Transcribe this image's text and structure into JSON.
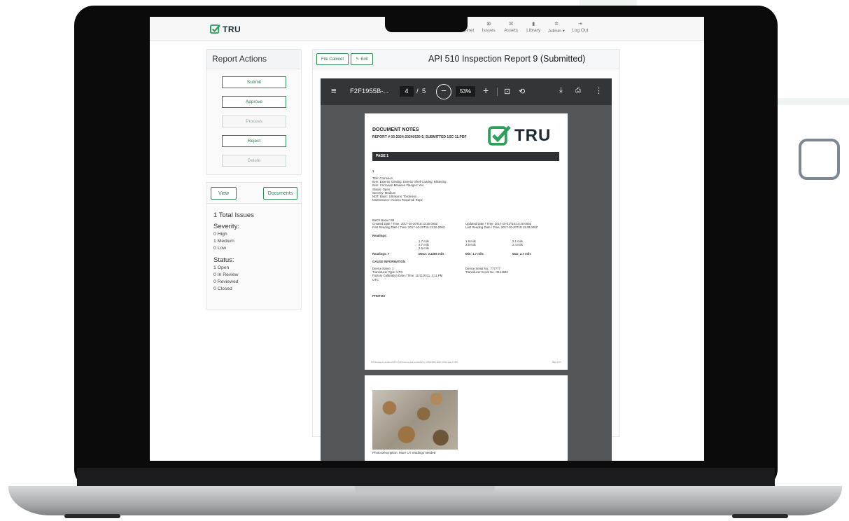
{
  "navbar": {
    "brand": "TRU",
    "items": [
      {
        "label": "File Cabinet",
        "icon": "grid-icon"
      },
      {
        "label": "Issues",
        "icon": "issues-icon"
      },
      {
        "label": "Assets",
        "icon": "assets-icon"
      },
      {
        "label": "Library",
        "icon": "book-icon"
      },
      {
        "label": "Admin ▾",
        "icon": "gear-icon"
      },
      {
        "label": "Log Out",
        "icon": "logout-icon"
      }
    ]
  },
  "report_actions": {
    "title": "Report Actions",
    "buttons": [
      {
        "label": "Submit",
        "enabled": true
      },
      {
        "label": "Approve",
        "enabled": true
      },
      {
        "label": "Process",
        "enabled": false
      },
      {
        "label": "Reject",
        "enabled": true
      },
      {
        "label": "Delete",
        "enabled": false
      }
    ]
  },
  "issues": {
    "view_label": "View",
    "documents_label": "Documents",
    "total": "1 Total Issues",
    "severity_label": "Severity:",
    "severity": [
      "0 High",
      "1 Medium",
      "0 Low"
    ],
    "status_label": "Status:",
    "status": [
      "1 Open",
      "0 In Review",
      "0 Reviewed",
      "0 Closed"
    ]
  },
  "main": {
    "file_cabinet_label": "File Cabinet",
    "edit_label": "Edit",
    "title": "API 510 Inspection Report 9  (Submitted)"
  },
  "pdf_viewer": {
    "file_name": "F2F1955B-...",
    "page_current": "4",
    "page_sep": "/",
    "page_total": "5",
    "zoom": "53%",
    "zoom_out": "−",
    "zoom_in": "+"
  },
  "document": {
    "heading": "DOCUMENT NOTES",
    "subheading": "REPORT # 03-2024-20240530-5, SUBMITTED 1SC-11.PDF",
    "logo_text": "TRU",
    "band": "PAGE 1",
    "item_number": "1",
    "lines_a": [
      "Title: Corrosion",
      "Item: Exterior Coating: Exterior Shell Coating: Blistering",
      "Item: Corrosion Between Flanges: Yes",
      "Status: Open",
      "Severity: Medium",
      "NDT: Basic: Ultrasonic Thickness",
      "Maintenance: Access Required: Rope"
    ],
    "batch_left": [
      "Batch Name: B5",
      "Created Date / Time: 2017-10-20T15:13:20.000Z",
      "First Reading Date / Time: 2017-10-20T15:13:20.000Z"
    ],
    "batch_right": [
      "Updated Date / Time: 2017-10-21T10:14:20.000Z",
      "Last Reading Date / Time: 2017-10-20T15:13:48.000Z"
    ],
    "readings_label": "Readings:",
    "readings_col1": [
      "1.7 mils",
      "2.7 mils",
      "2.5 mils"
    ],
    "readings_col2": [
      "1.9 mils",
      "2.5 mils"
    ],
    "readings_col3": [
      "2.1 mils",
      "2.4 mils"
    ],
    "readings_count": "Readings: 7",
    "readings_mean": "Mean: 2.2286 mils",
    "readings_min": "Min: 1.7 mils",
    "readings_max": "Max: 2.7 mils",
    "gauge_heading": "GAUGE INFORMATION",
    "gauge_left": [
      "Device Name: 1",
      "Transducer Type: UTG",
      "Factory Calibration Date / Time: 11/11/2011, 3:11 PM",
      "UTC"
    ],
    "gauge_right": [
      "Device Serial No.: 777777",
      "Transducer Serial No.: 3141592"
    ],
    "photos_heading": "PHOTOS",
    "footer_left": "This file/page is intended solely for authorized use and is protected by confidentiality and/or privacy laws © 2024",
    "footer_right": "Page 4 of 5",
    "photo_description": "Photo Description: More UT readings needed"
  }
}
